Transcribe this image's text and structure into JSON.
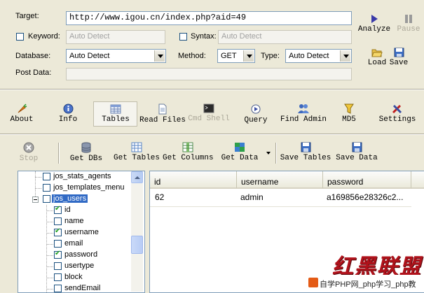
{
  "form": {
    "target_label": "Target:",
    "target_value": "http://www.igou.cn/index.php?aid=49",
    "keyword_label": "Keyword:",
    "keyword_value": "Auto Detect",
    "syntax_label": "Syntax:",
    "syntax_value": "Auto Detect",
    "database_label": "Database:",
    "database_value": "Auto Detect",
    "method_label": "Method:",
    "method_value": "GET",
    "type_label": "Type:",
    "type_value": "Auto Detect",
    "postdata_label": "Post Data:",
    "postdata_value": ""
  },
  "side_buttons": {
    "analyze": "Analyze",
    "pause": "Pause",
    "load": "Load",
    "save": "Save"
  },
  "nav": {
    "about": "About",
    "info": "Info",
    "tables": "Tables",
    "read_files": "Read Files",
    "cmd_shell": "Cmd Shell",
    "query": "Query",
    "find_admin": "Find Admin",
    "md5": "MD5",
    "settings": "Settings"
  },
  "toolbar": {
    "stop": "Stop",
    "get_dbs": "Get DBs",
    "get_tables": "Get Tables",
    "get_columns": "Get Columns",
    "get_data": "Get Data",
    "save_tables": "Save Tables",
    "save_data": "Save Data"
  },
  "tree": {
    "items": [
      {
        "label": "jos_stats_agents",
        "checked": false
      },
      {
        "label": "jos_templates_menu",
        "checked": false
      },
      {
        "label": "jos_users",
        "checked": false,
        "selected": true
      },
      {
        "label": "id",
        "checked": true
      },
      {
        "label": "name",
        "checked": false
      },
      {
        "label": "username",
        "checked": true
      },
      {
        "label": "email",
        "checked": false
      },
      {
        "label": "password",
        "checked": true
      },
      {
        "label": "usertype",
        "checked": false
      },
      {
        "label": "block",
        "checked": false
      },
      {
        "label": "sendEmail",
        "checked": false
      }
    ]
  },
  "grid": {
    "columns": [
      "id",
      "username",
      "password"
    ],
    "rows": [
      [
        "62",
        "admin",
        "a169856e28326c2..."
      ]
    ]
  },
  "watermark": {
    "title": "红黑联盟",
    "caption": "自学PHP网_php学习_php教"
  },
  "colors": {
    "background": "#ece9d8",
    "selection": "#316ac5",
    "watermark_red": "#b0121b"
  }
}
